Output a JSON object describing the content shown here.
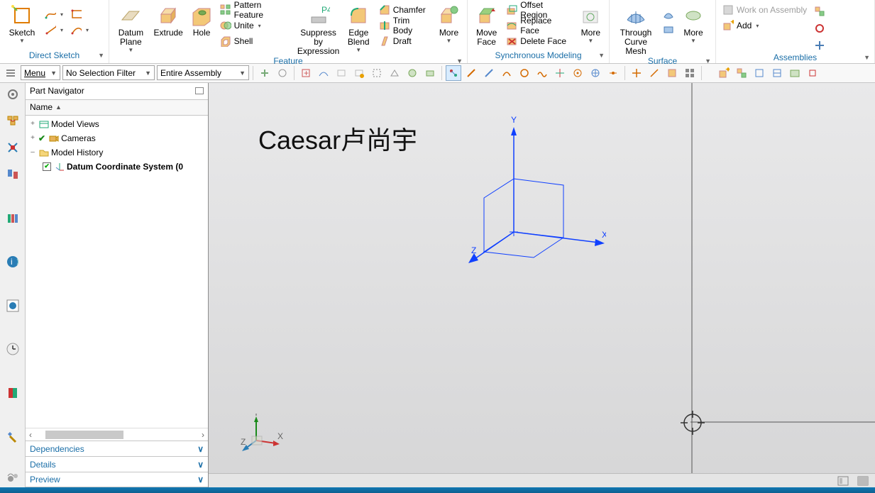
{
  "ribbon": {
    "groups": {
      "direct_sketch": {
        "title": "Direct Sketch",
        "sketch": "Sketch"
      },
      "feature": {
        "title": "Feature",
        "datum_plane": "Datum\nPlane",
        "extrude": "Extrude",
        "hole": "Hole",
        "pattern_feature": "Pattern Feature",
        "unite": "Unite",
        "shell": "Shell",
        "suppress_by_expression": "Suppress by\nExpression",
        "p4": "P4",
        "edge_blend": "Edge\nBlend",
        "chamfer": "Chamfer",
        "trim_body": "Trim Body",
        "draft": "Draft",
        "more": "More"
      },
      "sync": {
        "title": "Synchronous Modeling",
        "move_face": "Move\nFace",
        "offset_region": "Offset Region",
        "replace_face": "Replace Face",
        "delete_face": "Delete Face",
        "more": "More"
      },
      "surface": {
        "title": "Surface",
        "through_curve_mesh": "Through\nCurve Mesh",
        "more": "More"
      },
      "assemblies": {
        "title": "Assemblies",
        "work_on_assembly": "Work on Assembly",
        "add": "Add"
      }
    }
  },
  "toolbar2": {
    "menu": "Menu",
    "filter": "No Selection Filter",
    "scope": "Entire Assembly"
  },
  "nav": {
    "title": "Part Navigator",
    "col_name": "Name",
    "model_views": "Model Views",
    "cameras": "Cameras",
    "model_history": "Model History",
    "datum_cs": "Datum Coordinate System (0",
    "dependencies": "Dependencies",
    "details": "Details",
    "preview": "Preview"
  },
  "viewport": {
    "watermark": "Caesar卢尚宇",
    "axis": {
      "x": "X",
      "y": "Y",
      "z": "Z"
    },
    "axis_small": {
      "x": "X",
      "y": "Y",
      "z": "Z"
    }
  }
}
